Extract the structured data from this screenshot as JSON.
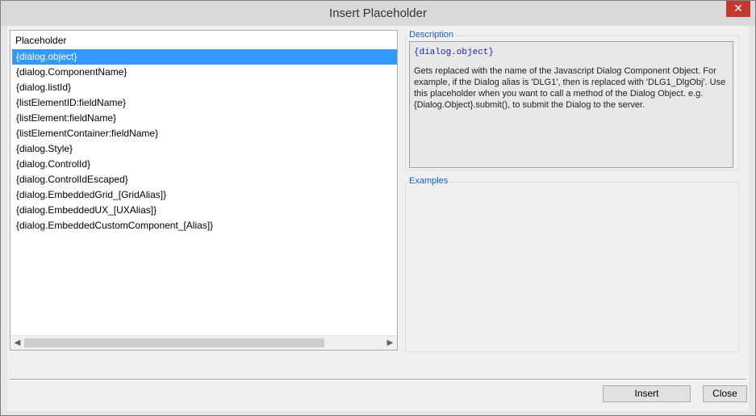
{
  "window": {
    "title": "Insert Placeholder",
    "close_glyph": "✕"
  },
  "list": {
    "header": "Placeholder",
    "items": [
      "{dialog.object}",
      "{dialog.ComponentName}",
      "{dialog.listId}",
      "{listElementID:fieldName}",
      "{listElement:fieldName}",
      "{listElementContainer:fieldName}",
      "{dialog.Style}",
      "{dialog.ControlId}",
      "{dialog.ControlIdEscaped}",
      "{dialog.EmbeddedGrid_[GridAlias]}",
      "{dialog.EmbeddedUX_[UXAlias]}",
      "{dialog.EmbeddedCustomComponent_[Alias]}"
    ],
    "selected_index": 0,
    "scroll_left_glyph": "◀",
    "scroll_right_glyph": "▶"
  },
  "description": {
    "label": "Description",
    "code": "{dialog.object}",
    "text": "Gets replaced with the name of the Javascript Dialog Component Object. For example, if the Dialog alias is 'DLG1', then is replaced with 'DLG1_DlgObj'. Use this placeholder when you want to call a method of the Dialog Object. e.g. {Dialog.Object}.submit(), to submit the Dialog to the server."
  },
  "examples": {
    "label": "Examples"
  },
  "buttons": {
    "insert": "Insert",
    "close": "Close"
  },
  "colors": {
    "selection": "#3399ff",
    "group_label": "#1d5ec6",
    "close_button": "#c7372f"
  }
}
